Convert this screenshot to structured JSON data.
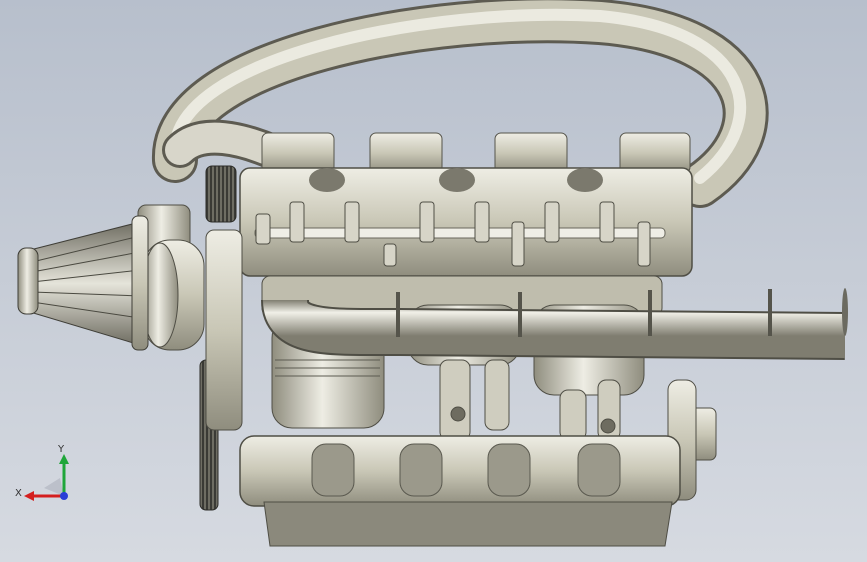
{
  "viewport": {
    "background_top": "#b7bfcc",
    "background_bottom": "#d6dae1",
    "model_color": "#c9c7b6",
    "model_shadow": "#8f8d7e",
    "model_highlight": "#eeede4"
  },
  "triad": {
    "x_label": "X",
    "y_label": "Y",
    "x_color": "#d41f1f",
    "y_color": "#1fa63a",
    "z_color": "#2a3fd6"
  }
}
